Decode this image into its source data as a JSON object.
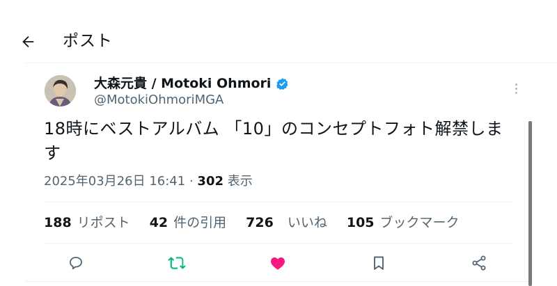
{
  "header": {
    "title": "ポスト"
  },
  "author": {
    "name": "大森元貴 / Motoki Ohmori",
    "handle": "@MotokiOhmoriMGA",
    "verified": true
  },
  "post": {
    "text": "18時にベストアルバム 「10」のコンセプトフォト解禁します",
    "datetime": "2025年03月26日 16:41",
    "separator": "·",
    "views_count": "302",
    "views_label": "表示"
  },
  "stats": [
    {
      "count": "188",
      "label": "リポスト"
    },
    {
      "count": "42",
      "label": "件の引用"
    },
    {
      "count": "726",
      "label": "いいね"
    },
    {
      "count": "105",
      "label": "ブックマーク"
    }
  ],
  "actions": {
    "reply_icon": "reply-icon",
    "repost_icon": "repost-icon",
    "like_icon": "like-icon",
    "bookmark_icon": "bookmark-icon",
    "share_icon": "share-icon"
  },
  "colors": {
    "verified_blue": "#1d9bf0",
    "repost_green": "#00ba7c",
    "like_pink": "#f91880",
    "secondary_text": "#536471"
  }
}
